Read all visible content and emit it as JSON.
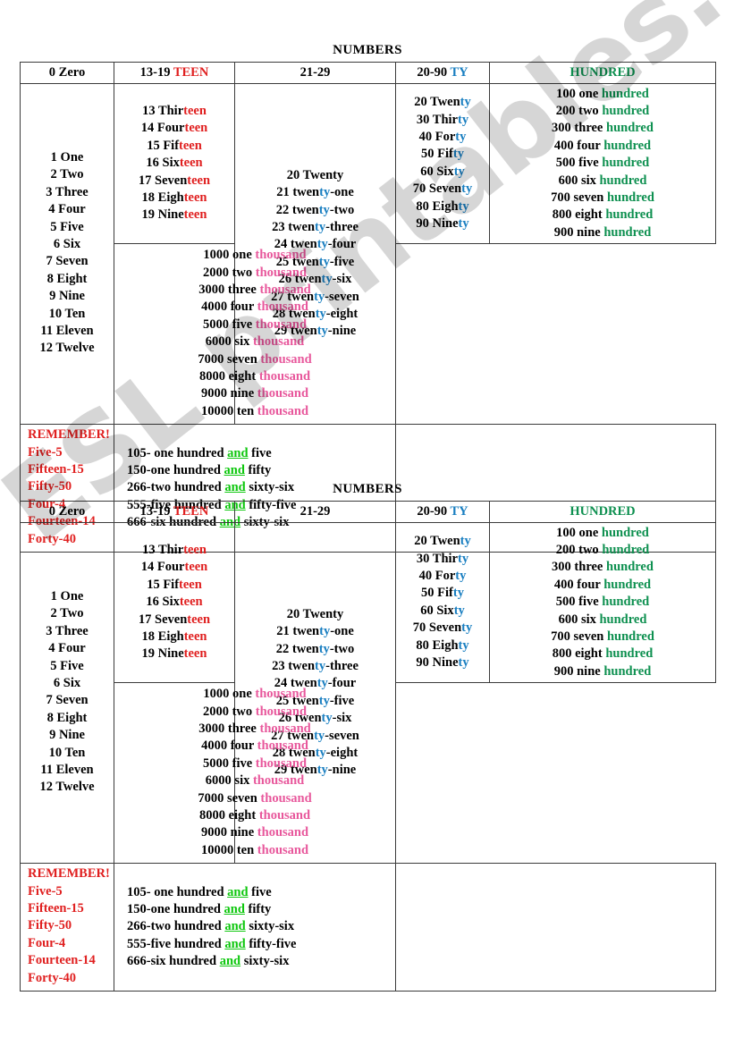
{
  "watermark": {
    "text": "ESL printables.com"
  },
  "colors": {
    "red": "#e02020",
    "blue": "#1a7fc1",
    "green_hundred": "#0e9050",
    "green_and": "#0ec70e",
    "pink_thousand": "#e8589c",
    "black": "#000000",
    "border": "#3b3b3b"
  },
  "worksheet": {
    "title": "NUMBERS",
    "headers": {
      "units": "0 Zero",
      "teen_prefix": "13-19 ",
      "teen_suffix": "TEEN",
      "twenties": "21-29",
      "ty_prefix": "20-90 ",
      "ty_suffix": "TY",
      "hundred": "HUNDRED"
    },
    "units": [
      "1 One",
      "2 Two",
      "3 Three",
      "4 Four",
      "5 Five",
      "6 Six",
      "7 Seven",
      "8 Eight",
      "9 Nine",
      "10 Ten",
      "11 Eleven",
      "12 Twelve"
    ],
    "teens": [
      {
        "base": "13 Thir",
        "suffix": "teen"
      },
      {
        "base": "14 Four",
        "suffix": "teen"
      },
      {
        "base": "15 Fif",
        "suffix": "teen"
      },
      {
        "base": "16 Six",
        "suffix": "teen"
      },
      {
        "base": "17 Seven",
        "suffix": "teen"
      },
      {
        "base": "18 Eigh",
        "suffix": "teen"
      },
      {
        "base": "19 Nine",
        "suffix": "teen"
      }
    ],
    "twenties": [
      {
        "pre": "20 Twenty",
        "mid": "",
        "post": ""
      },
      {
        "pre": "21 twen",
        "mid": "ty",
        "post": "-one"
      },
      {
        "pre": "22 twen",
        "mid": "ty",
        "post": "-two"
      },
      {
        "pre": "23 twen",
        "mid": "ty",
        "post": "-three"
      },
      {
        "pre": "24 twen",
        "mid": "ty",
        "post": "-four"
      },
      {
        "pre": "25 twen",
        "mid": "ty",
        "post": "-five"
      },
      {
        "pre": "26 twen",
        "mid": "ty",
        "post": "-six"
      },
      {
        "pre": "27 twen",
        "mid": "ty",
        "post": "-seven"
      },
      {
        "pre": "28 twen",
        "mid": "ty",
        "post": "-eight"
      },
      {
        "pre": "29 twen",
        "mid": "ty",
        "post": "-nine"
      }
    ],
    "tys": [
      {
        "base": "20 Twen",
        "suffix": "ty"
      },
      {
        "base": "30 Thir",
        "suffix": "ty"
      },
      {
        "base": "40 For",
        "suffix": "ty"
      },
      {
        "base": "50 Fif",
        "suffix": "ty"
      },
      {
        "base": "60 Six",
        "suffix": "ty"
      },
      {
        "base": "70 Seven",
        "suffix": "ty"
      },
      {
        "base": "80 Eigh",
        "suffix": "ty"
      },
      {
        "base": "90 Nine",
        "suffix": "ty"
      }
    ],
    "hundreds": [
      {
        "base": "100 one ",
        "suffix": "hundred"
      },
      {
        "base": "200 two ",
        "suffix": "hundred"
      },
      {
        "base": "300 three ",
        "suffix": "hundred"
      },
      {
        "base": "400 four ",
        "suffix": "hundred"
      },
      {
        "base": "500 five ",
        "suffix": "hundred"
      },
      {
        "base": "600 six ",
        "suffix": "hundred"
      },
      {
        "base": "700 seven ",
        "suffix": "hundred"
      },
      {
        "base": "800 eight ",
        "suffix": "hundred"
      },
      {
        "base": "900 nine ",
        "suffix": "hundred"
      }
    ],
    "thousands": [
      {
        "base": "1000 one ",
        "suffix": "thousand"
      },
      {
        "base": "2000 two ",
        "suffix": "thousand"
      },
      {
        "base": "3000 three ",
        "suffix": "thousand"
      },
      {
        "base": "4000 four ",
        "suffix": "thousand"
      },
      {
        "base": "5000 five ",
        "suffix": "thousand"
      },
      {
        "base": "6000 six ",
        "suffix": "thousand"
      },
      {
        "base": "7000 seven ",
        "suffix": "thousand"
      },
      {
        "base": "8000 eight ",
        "suffix": "thousand"
      },
      {
        "base": "9000 nine ",
        "suffix": "thousand"
      },
      {
        "base": "10000 ten ",
        "suffix": "thousand"
      }
    ],
    "remember": {
      "heading": "REMEMBER!",
      "items": [
        "Five-5",
        "Fifteen-15",
        "Fifty-50",
        "Four-4",
        "Fourteen-14",
        "Forty-40"
      ]
    },
    "examples": [
      {
        "pre": "105- one hundred ",
        "and": "and",
        "post": " five"
      },
      {
        "pre": "150-one hundred ",
        "and": "and",
        "post": " fifty"
      },
      {
        "pre": "266-two hundred ",
        "and": "and",
        "post": " sixty-six"
      },
      {
        "pre": "555-five hundred ",
        "and": "and",
        "post": " fifty-five"
      },
      {
        "pre": "666-six hundred ",
        "and": "and",
        "post": " sixty-six"
      }
    ]
  }
}
